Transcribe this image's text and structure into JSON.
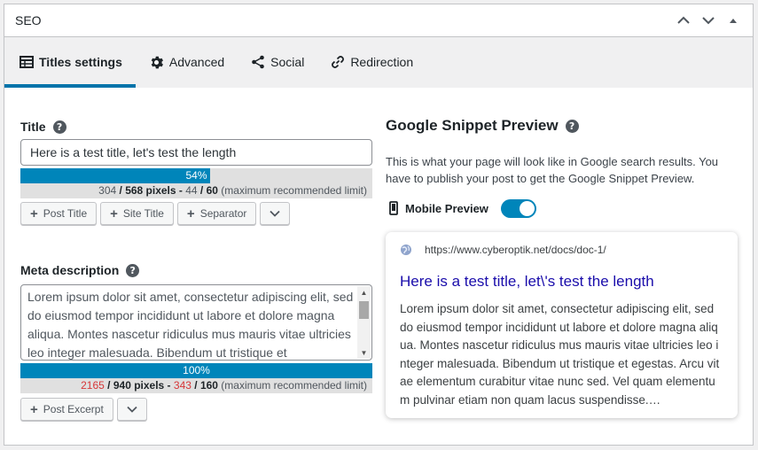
{
  "panel": {
    "title": "SEO"
  },
  "tabs": [
    {
      "label": "Titles settings",
      "icon": "table-icon",
      "active": true
    },
    {
      "label": "Advanced",
      "icon": "gear-icon",
      "active": false
    },
    {
      "label": "Social",
      "icon": "share-icon",
      "active": false
    },
    {
      "label": "Redirection",
      "icon": "link-icon",
      "active": false
    }
  ],
  "title_field": {
    "label": "Title",
    "value": "Here is a test title, let's test the length",
    "meter_percent_text": "54%",
    "meter_fraction": 0.54,
    "pixels_used": "304",
    "pixels_sep": " / ",
    "pixels_max": "568 pixels",
    "chars_sep": " - ",
    "chars_used": "44",
    "chars_sep2": " / ",
    "chars_max": "60",
    "limit_note": " (maximum recommended limit)",
    "buttons": [
      "Post Title",
      "Site Title",
      "Separator"
    ]
  },
  "meta_field": {
    "label": "Meta description",
    "value": "Lorem ipsum dolor sit amet, consectetur adipiscing elit, sed do eiusmod tempor incididunt ut labore et dolore magna aliqua. Montes nascetur ridiculus mus mauris vitae ultricies leo integer malesuada. Bibendum ut tristique et",
    "meter_percent_text": "100%",
    "meter_fraction": 1.0,
    "pixels_used": "2165",
    "pixels_sep": " / ",
    "pixels_max": "940 pixels",
    "chars_sep": " - ",
    "chars_used": "343",
    "chars_sep2": " / ",
    "chars_max": "160",
    "limit_note": " (maximum recommended limit)",
    "buttons": [
      "Post Excerpt"
    ]
  },
  "preview": {
    "heading": "Google Snippet Preview",
    "description": "This is what your page will look like in Google search results. You have to publish your post to get the Google Snippet Preview.",
    "mobile_label": "Mobile Preview",
    "mobile_enabled": true,
    "url": "https://www.cyberoptik.net/docs/doc-1/",
    "title": "Here is a test title, let\\'s test the length",
    "snippet": "Lorem ipsum dolor sit amet, consectetur adipiscing elit, sed do eiusmod tempor incididunt ut labore et dolore magna aliqua. Montes nascetur ridiculus mus mauris vitae ultricies leo integer malesuada. Bibendum ut tristique et egestas. Arcu vitae elementum curabitur vitae nunc sed. Vel quam elementum pulvinar etiam non quam lacus suspendisse.…"
  },
  "colors": {
    "accent": "#0085ba",
    "tab_underline": "#0073aa",
    "over_limit": "#d63638",
    "link_title": "#1a0dab"
  }
}
